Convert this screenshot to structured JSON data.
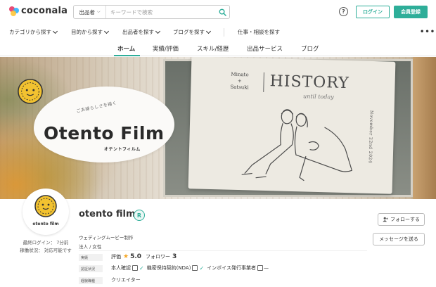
{
  "header": {
    "logo_text": "coconala",
    "search_category": "出品者",
    "search_placeholder": "キーワードで検索",
    "help_label": "?",
    "login_label": "ログイン",
    "signup_label": "会員登録"
  },
  "catnav": {
    "items": [
      {
        "label": "カテゴリから探す"
      },
      {
        "label": "目的から探す"
      },
      {
        "label": "出品者を探す"
      },
      {
        "label": "ブログを探す"
      },
      {
        "label": "仕事・相談を探す"
      }
    ],
    "more_label": "•••"
  },
  "tabs": [
    {
      "label": "ホーム",
      "active": true
    },
    {
      "label": "実績/評価"
    },
    {
      "label": "スキル/経歴"
    },
    {
      "label": "出品サービス"
    },
    {
      "label": "ブログ"
    }
  ],
  "cover": {
    "title": "Otento Film",
    "subtitle": "ご夫婦らしさを描く",
    "kana": "オテントフィルム",
    "card_names_1": "Minato",
    "card_names_plus": "+",
    "card_names_2": "Satsuki",
    "card_history": "HISTORY",
    "card_until": "until today",
    "card_date": "November 22nd 2024"
  },
  "profile": {
    "avatar_label": "otento film",
    "name": "otento film",
    "badge": "R",
    "last_login": "最終ログイン： 7分前",
    "status": "稼働状況： 対応可能です",
    "occupation": "ウェディングムービー制作",
    "type": "法人 / 女性",
    "follow_label": "フォローする",
    "message_label": "メッセージを送る"
  },
  "stats": {
    "row1_label": "実績",
    "rating_label": "評価",
    "rating_value": "5.0",
    "followers_label": "フォロワー",
    "followers_value": "3",
    "row2_label": "認証状況",
    "verify_identity": "本人確認",
    "verify_nda": "機密保持契約(NDA)",
    "verify_invoice": "インボイス発行事業者",
    "verify_dash": "—",
    "row3_label": "経験職種",
    "experience": "クリエイター"
  },
  "colors": {
    "accent": "#2eae99",
    "star": "#f5a623"
  }
}
